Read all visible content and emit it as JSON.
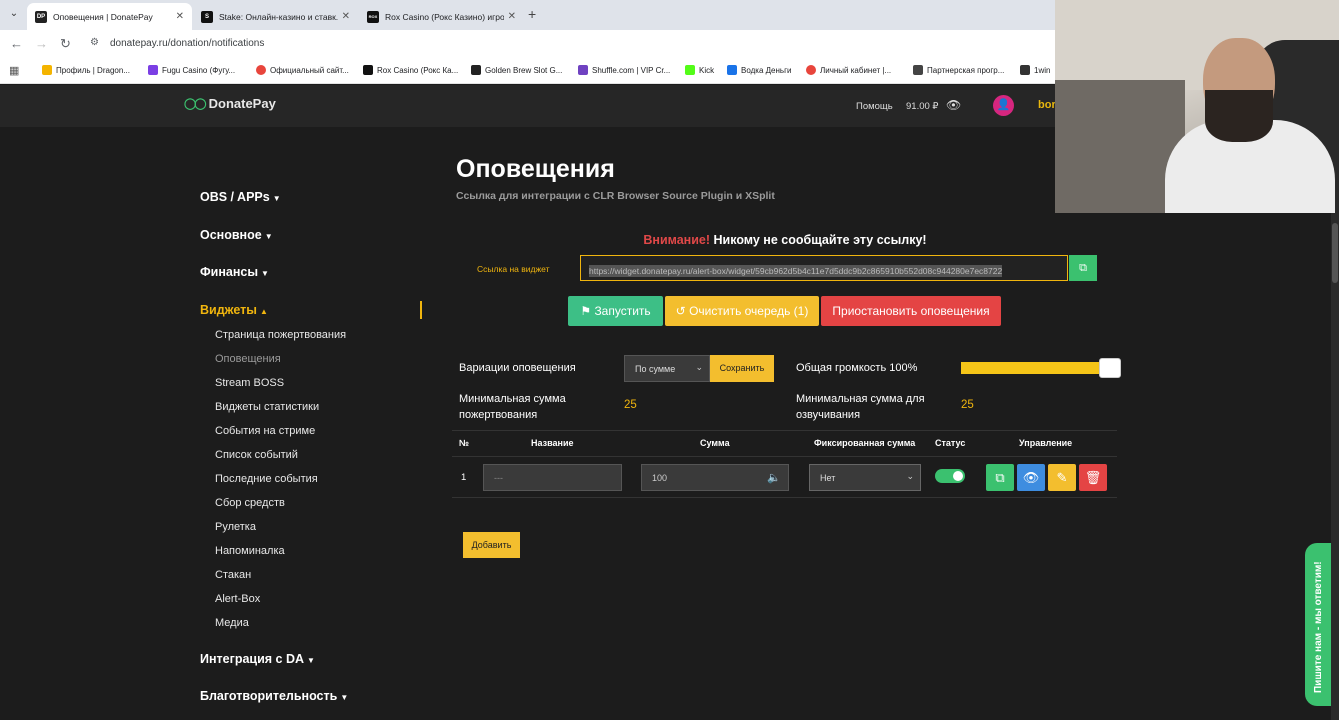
{
  "browser": {
    "tabs": [
      {
        "title": "Оповещения | DonatePay",
        "favicon": "DP",
        "active": true
      },
      {
        "title": "Stake: Онлайн-казино и ставк...",
        "favicon": "S",
        "active": false
      },
      {
        "title": "Rox Casino (Рокс Казино) игро...",
        "favicon": "ROX",
        "active": false
      }
    ],
    "new_tab": "+",
    "url": "donatepay.ru/donation/notifications",
    "bookmarks": [
      {
        "label": "Профиль | Dragon...",
        "color": "#f4b400"
      },
      {
        "label": "Fugu Casino (Фугу...",
        "color": "#7b3fe4"
      },
      {
        "label": "Официальный сайт...",
        "color": "#e8453c"
      },
      {
        "label": "Rox Casino (Рокс Ка...",
        "color": "#111111"
      },
      {
        "label": "Golden Brew Slot G...",
        "color": "#222222"
      },
      {
        "label": "Shuffle.com | VIP Cr...",
        "color": "#6f42c1"
      },
      {
        "label": "Kick",
        "color": "#53fc18"
      },
      {
        "label": "Водка Деньги",
        "color": "#1a73e8"
      },
      {
        "label": "Личный кабинет |...",
        "color": "#e8453c"
      },
      {
        "label": "Партнерская прогр...",
        "color": "#444444"
      },
      {
        "label": "1win",
        "color": "#333333"
      }
    ]
  },
  "header": {
    "logo": "DonatePay",
    "help": "Помощь",
    "balance": "91.00 ₽",
    "user": "bor"
  },
  "sidebar": {
    "sections": [
      {
        "label": "OBS / APPs",
        "arrow": "▼"
      },
      {
        "label": "Основное",
        "arrow": "▼"
      },
      {
        "label": "Финансы",
        "arrow": "▼"
      },
      {
        "label": "Виджеты",
        "arrow": "▲"
      },
      {
        "label": "Интеграция с DA",
        "arrow": "▼"
      },
      {
        "label": "Благотворительность",
        "arrow": "▼"
      }
    ],
    "widget_items": [
      "Страница пожертвования",
      "Оповещения",
      "Stream BOSS",
      "Виджеты статистики",
      "События на стриме",
      "Список событий",
      "Последние события",
      "Сбор средств",
      "Рулетка",
      "Напоминалка",
      "Стакан",
      "Alert-Box",
      "Медиа"
    ]
  },
  "main": {
    "title": "Оповещения",
    "subtitle": "Ссылка для интеграции с CLR Browser Source Plugin и XSplit",
    "warning_red": "Внимание!",
    "warning_text": " Никому не сообщайте эту ссылку!",
    "link_label": "Ссылка на виджет",
    "widget_link": "https://widget.donatepay.ru/alert-box/widget/59cb962d5b4c11e7d5ddc9b2c865910b552d08c944280e7ec8722",
    "btn_start": "Запустить",
    "btn_clear": "Очистить очередь (1)",
    "btn_pause": "Приостановить оповещения",
    "variations_label": "Вариации оповещения",
    "variation_value": "По сумме",
    "save_label": "Сохранить",
    "volume_label": "Общая громкость 100%",
    "volume_level": 1.0,
    "min_donation_label": "Минимальная сумма пожертвования",
    "min_donation_value": "25",
    "min_voice_label": "Минимальная сумма для озвучивания",
    "min_voice_value": "25",
    "table": {
      "headers": [
        "№",
        "Название",
        "Сумма",
        "Фиксированная сумма",
        "Статус",
        "Управление"
      ],
      "rows": [
        {
          "no": "1",
          "name": "---",
          "sum": "100",
          "fixed": "Нет",
          "status": true
        }
      ]
    },
    "add_label": "Добавить"
  },
  "chat_widget": "Пишите нам - мы ответим!"
}
